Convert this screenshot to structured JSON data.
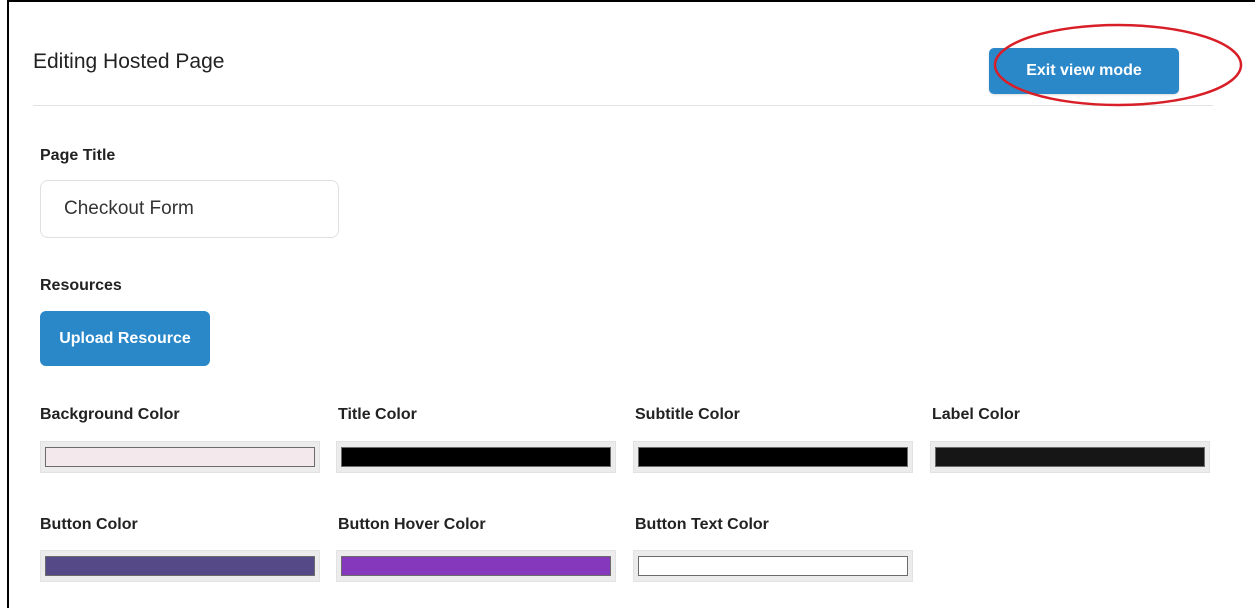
{
  "header": {
    "title": "Editing Hosted Page",
    "exit_button_label": "Exit view mode"
  },
  "page_title": {
    "label": "Page Title",
    "value": "Checkout Form"
  },
  "resources": {
    "label": "Resources",
    "upload_button_label": "Upload Resource"
  },
  "colors": [
    {
      "label": "Background Color",
      "value": "#f3e9ec"
    },
    {
      "label": "Title Color",
      "value": "#000000"
    },
    {
      "label": "Subtitle Color",
      "value": "#000000"
    },
    {
      "label": "Label Color",
      "value": "#161616"
    },
    {
      "label": "Button Color",
      "value": "#564988"
    },
    {
      "label": "Button Hover Color",
      "value": "#8638bc"
    },
    {
      "label": "Button Text Color",
      "value": "#ffffff"
    }
  ],
  "theme": {
    "accent": "#2a88c9",
    "annotation": "#d81e27"
  }
}
